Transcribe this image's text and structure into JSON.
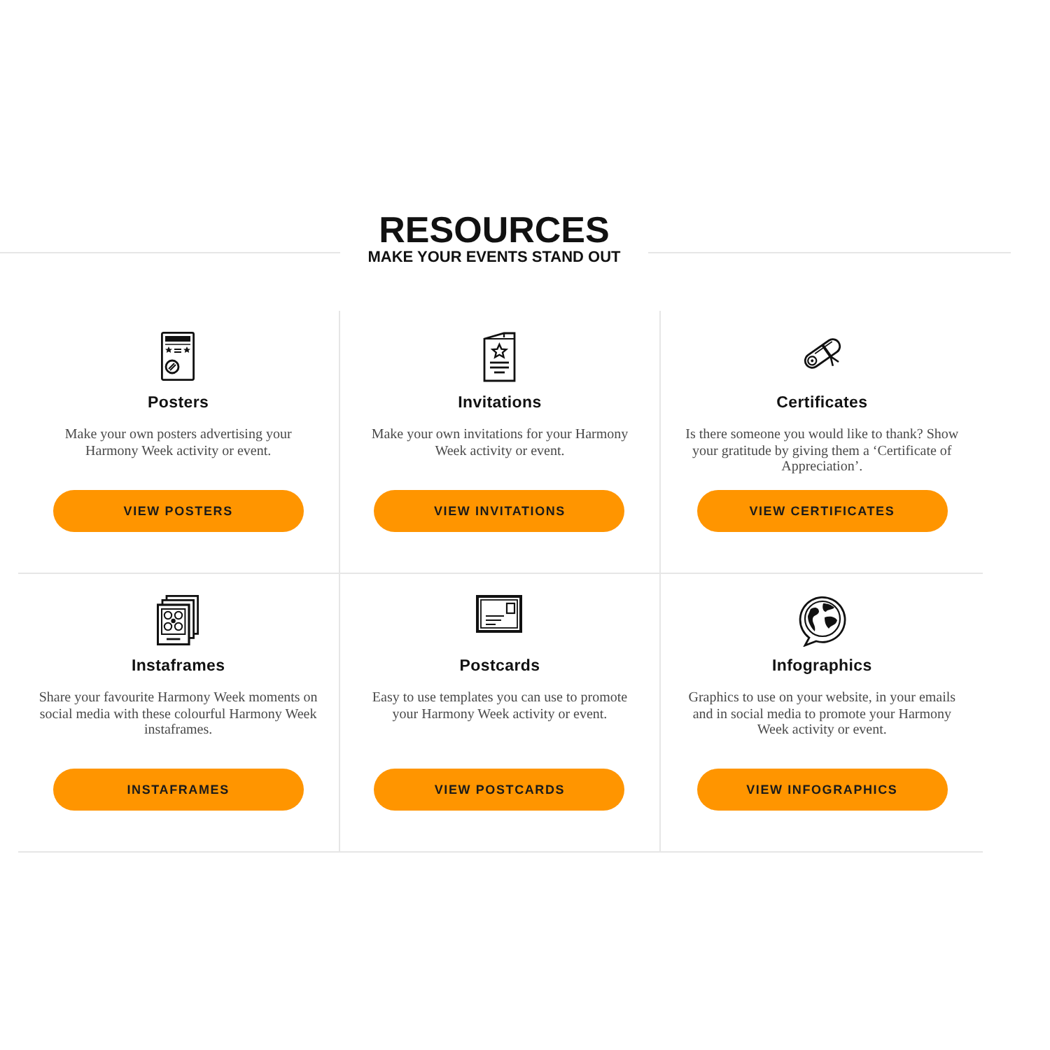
{
  "header": {
    "title": "RESOURCES",
    "subtitle": "MAKE YOUR EVENTS STAND OUT"
  },
  "resources": [
    {
      "kind": "poster",
      "title": "Posters",
      "description": "Make your own posters advertising your Harmony Week activity or event.",
      "button": "VIEW POSTERS"
    },
    {
      "kind": "invitation",
      "title": "Invitations",
      "description": "Make your own invitations for your Harmony Week activity or event.",
      "button": "VIEW INVITATIONS"
    },
    {
      "kind": "certificate",
      "title": "Certificates",
      "description": "Is there someone you would like to thank? Show your gratitude by giving them a ‘Certificate of Appreciation’.",
      "button": "VIEW CERTIFICATES"
    },
    {
      "kind": "instaframe",
      "title": "Instaframes",
      "description": "Share your favourite Harmony Week moments on social media with these colourful Harmony Week instaframes.",
      "button": "INSTAFRAMES"
    },
    {
      "kind": "postcard",
      "title": "Postcards",
      "description": "Easy to use templates you can use to promote your Harmony Week activity or event.",
      "button": "VIEW POSTCARDS"
    },
    {
      "kind": "infographic",
      "title": "Infographics",
      "description": "Graphics to use on your website, in your emails and in social media to promote your Harmony Week activity or event.",
      "button": "VIEW INFOGRAPHICS"
    }
  ]
}
